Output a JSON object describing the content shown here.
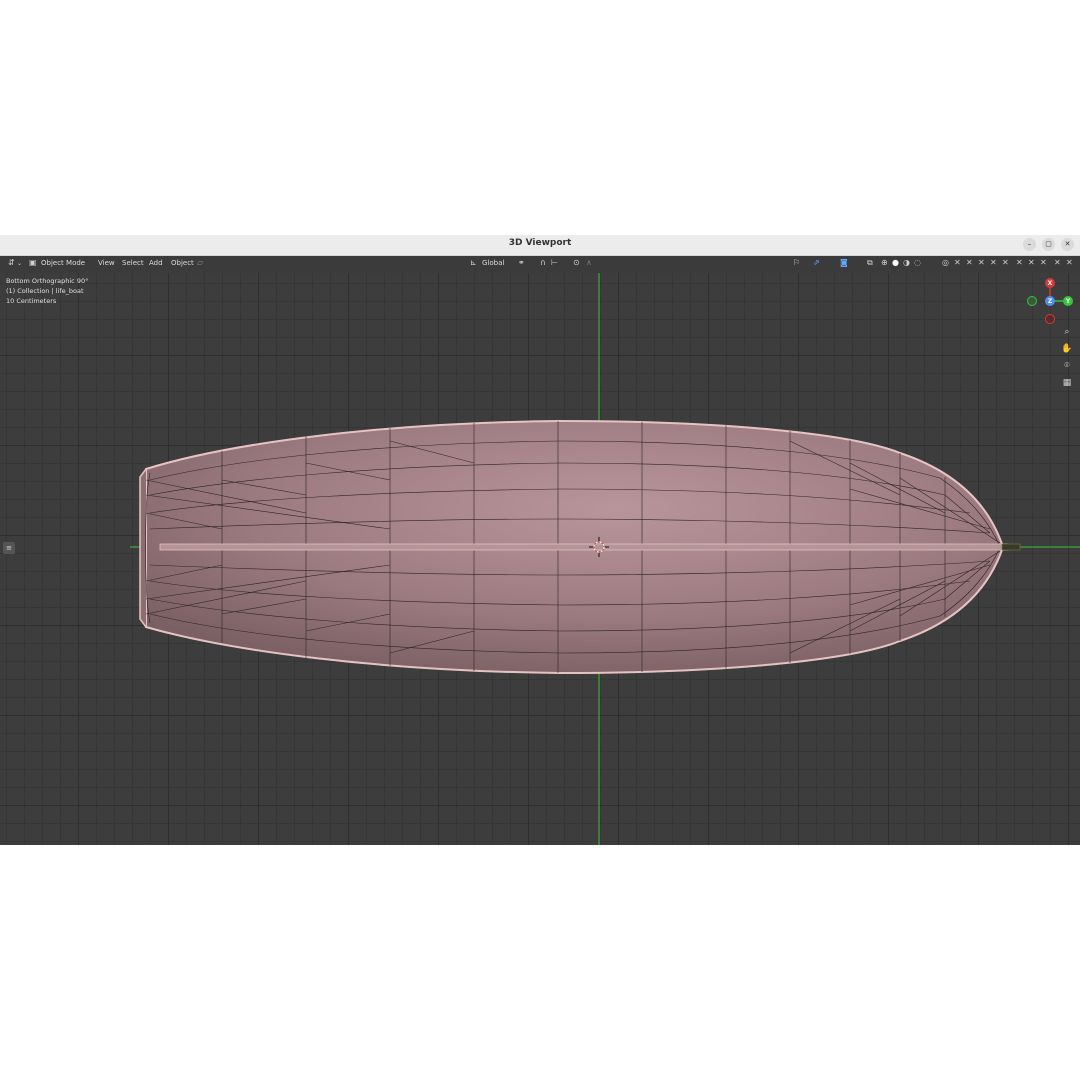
{
  "window": {
    "title": "3D Viewport",
    "controls": [
      "–",
      "▢",
      "✕"
    ]
  },
  "header": {
    "editor_type_icon": "⇵",
    "mode_label": "Object Mode",
    "menus": [
      "View",
      "Select",
      "Add",
      "Object"
    ],
    "transform_orientation": "Global"
  },
  "viewport_overlay": {
    "view_name": "Bottom Orthographic 90°",
    "collection_info": "(1) Collection | life_boat",
    "scale_info": "10 Centimeters"
  },
  "navigation": {
    "zoom_icon": "zoom-icon",
    "pan_icon": "hand-icon",
    "camera_icon": "camera-icon",
    "ortho_icon": "grid-icon"
  },
  "gizmo": {
    "x_label": "X",
    "y_label": "Y",
    "z_label": "Z"
  },
  "colors": {
    "viewport_bg": "#3d3d3d",
    "hull_fill": "#a07f83",
    "hull_edge": "#e8c8c8",
    "axis_green": "#35c43a",
    "axis_red": "#d33a3a",
    "axis_blue": "#4d8ff0"
  }
}
